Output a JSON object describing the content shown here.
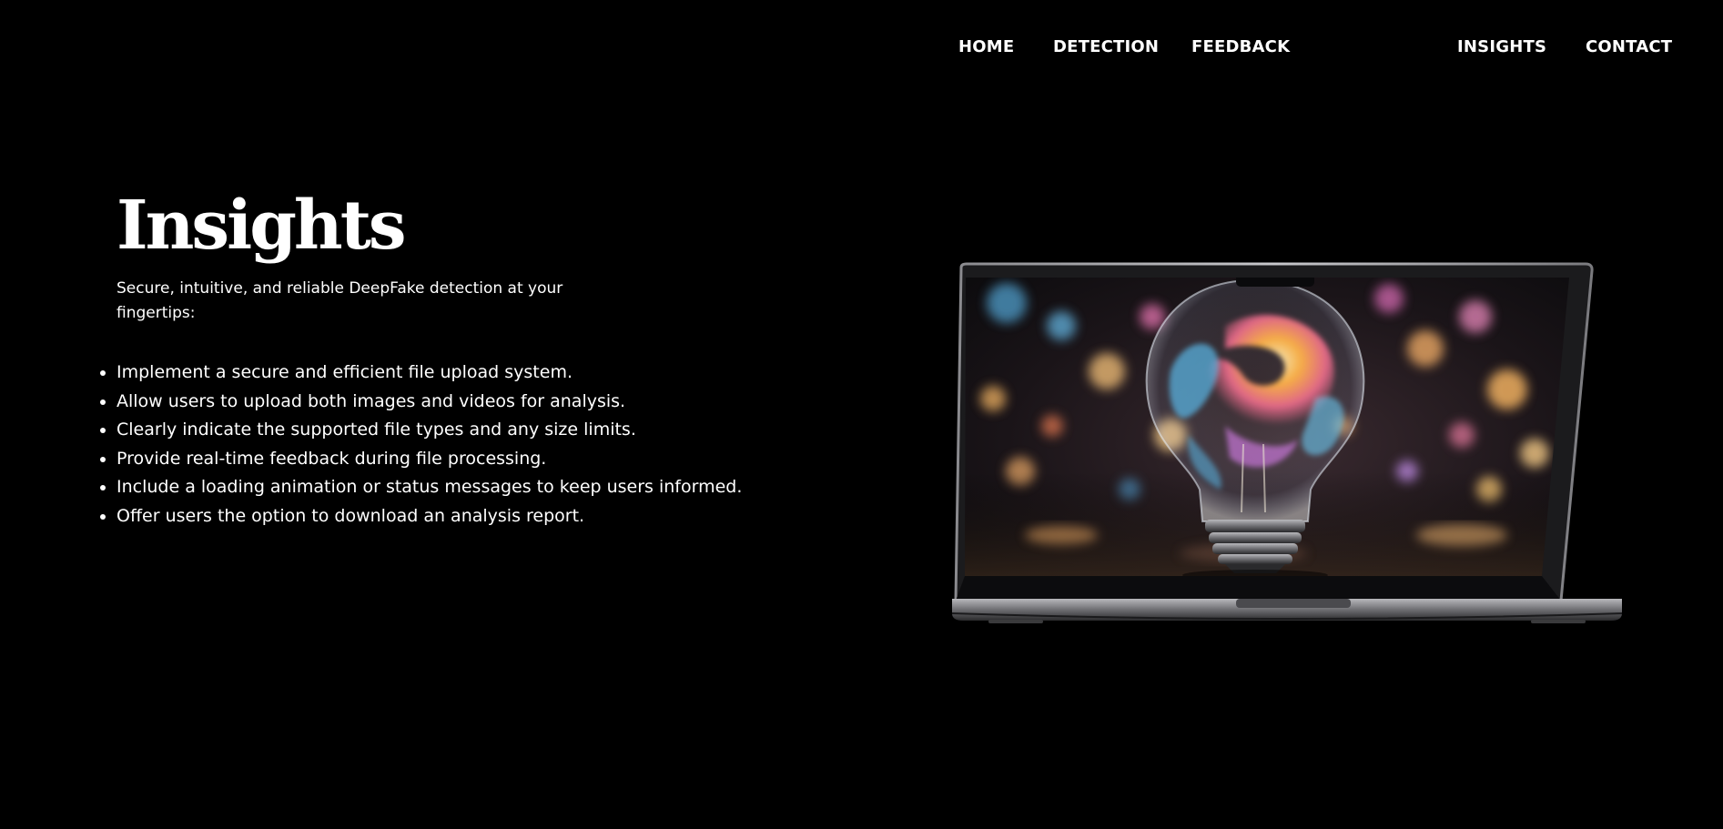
{
  "nav": {
    "home": "HOME",
    "detection": "DETECTION",
    "feedback": "FEEDBACK",
    "insights": "INSIGHTS",
    "contact": "CONTACT"
  },
  "hero": {
    "title": "Insights",
    "subtitle": "Secure, intuitive, and reliable DeepFake detection at your fingertips:",
    "features": [
      "Implement a secure and efficient file upload system.",
      "Allow users to upload both images and videos for analysis.",
      "Clearly indicate the supported file types and any size limits.",
      "Provide real-time feedback during file processing.",
      "Include a loading animation or status messages to keep users informed.",
      "Offer users the option to download an analysis report."
    ]
  },
  "image": {
    "subject": "laptop-showing-lightbulb-icon"
  },
  "colors": {
    "background": "#000000",
    "text": "#ffffff",
    "laptop_frame": "#9a9a9a"
  }
}
